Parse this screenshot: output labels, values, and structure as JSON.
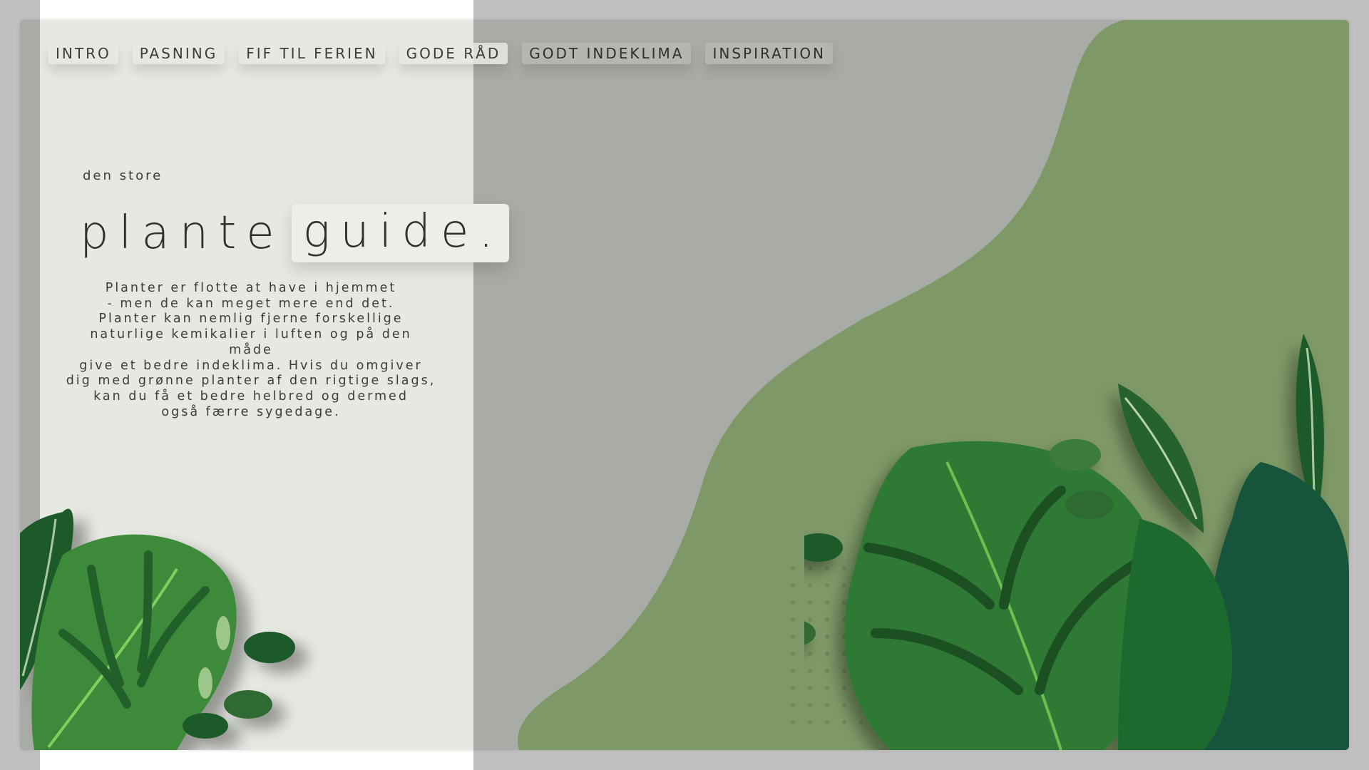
{
  "nav": {
    "items": [
      "INTRO",
      "PASNING",
      "FIF TIL FERIEN",
      "GODE RÅD",
      "GODT INDEKLIMA",
      "INSPIRATION"
    ]
  },
  "hero": {
    "kicker": "den store",
    "title_plain": "plante",
    "title_highlight": "guide.",
    "intro_lines": [
      "Planter er flotte at have i hjemmet",
      "- men de kan meget mere end det.",
      "Planter kan nemlig fjerne forskellige",
      "naturlige kemikalier i luften og på den måde",
      "give et bedre indeklima. Hvis du omgiver",
      "dig med grønne planter af den rigtige slags,",
      "kan du få et bedre helbred og dermed",
      "også færre sygedage."
    ]
  },
  "icons": {
    "left_plant": "monstera-leaves-illustration",
    "right_plant": "monstera-calathea-leaves-illustration",
    "dot_pattern": "dot-grid-decoration"
  },
  "colors": {
    "page_bg": "#c0c0c0",
    "stage_bg": "#a9aca6",
    "left_panel": "#e6e8e2",
    "blob_green": "#7e9967",
    "leaf_dark": "#1f5a2a",
    "leaf_mid": "#2f7a36",
    "leaf_light": "#5fa348"
  }
}
